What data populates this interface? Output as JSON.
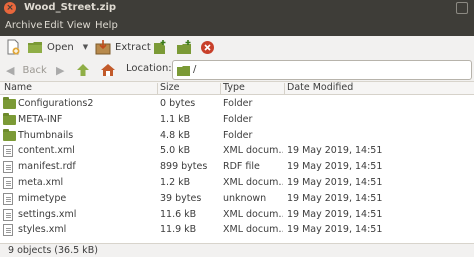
{
  "window": {
    "title": "Wood_Street.zip"
  },
  "menu": {
    "archive": "Archive",
    "edit": "Edit",
    "view": "View",
    "help": "Help"
  },
  "toolbar": {
    "open_label": "Open",
    "extract_label": "Extract"
  },
  "location": {
    "back_label": "Back",
    "label": "Location:",
    "path": "/"
  },
  "columns": {
    "name": "Name",
    "size": "Size",
    "type": "Type",
    "date": "Date Modified"
  },
  "files": [
    {
      "name": "Configurations2",
      "size": "0 bytes",
      "type": "Folder",
      "date": "",
      "icon": "folder-icon"
    },
    {
      "name": "META-INF",
      "size": "1.1 kB",
      "type": "Folder",
      "date": "",
      "icon": "folder-icon"
    },
    {
      "name": "Thumbnails",
      "size": "4.8 kB",
      "type": "Folder",
      "date": "",
      "icon": "folder-icon"
    },
    {
      "name": "content.xml",
      "size": "5.0 kB",
      "type": "XML docum…",
      "date": "19 May 2019, 14:51",
      "icon": "file-icon"
    },
    {
      "name": "manifest.rdf",
      "size": "899 bytes",
      "type": "RDF file",
      "date": "19 May 2019, 14:51",
      "icon": "file-icon"
    },
    {
      "name": "meta.xml",
      "size": "1.2 kB",
      "type": "XML docum…",
      "date": "19 May 2019, 14:51",
      "icon": "file-icon"
    },
    {
      "name": "mimetype",
      "size": "39 bytes",
      "type": "unknown",
      "date": "19 May 2019, 14:51",
      "icon": "file-icon"
    },
    {
      "name": "settings.xml",
      "size": "11.6 kB",
      "type": "XML docum…",
      "date": "19 May 2019, 14:51",
      "icon": "file-icon"
    },
    {
      "name": "styles.xml",
      "size": "11.9 kB",
      "type": "XML docum…",
      "date": "19 May 2019, 14:51",
      "icon": "file-icon"
    }
  ],
  "status": {
    "text": "9 objects (36.5 kB)"
  },
  "colors": {
    "titlebar": "#3e3d38",
    "close": "#e8673c",
    "folder": "#7b9a36"
  }
}
